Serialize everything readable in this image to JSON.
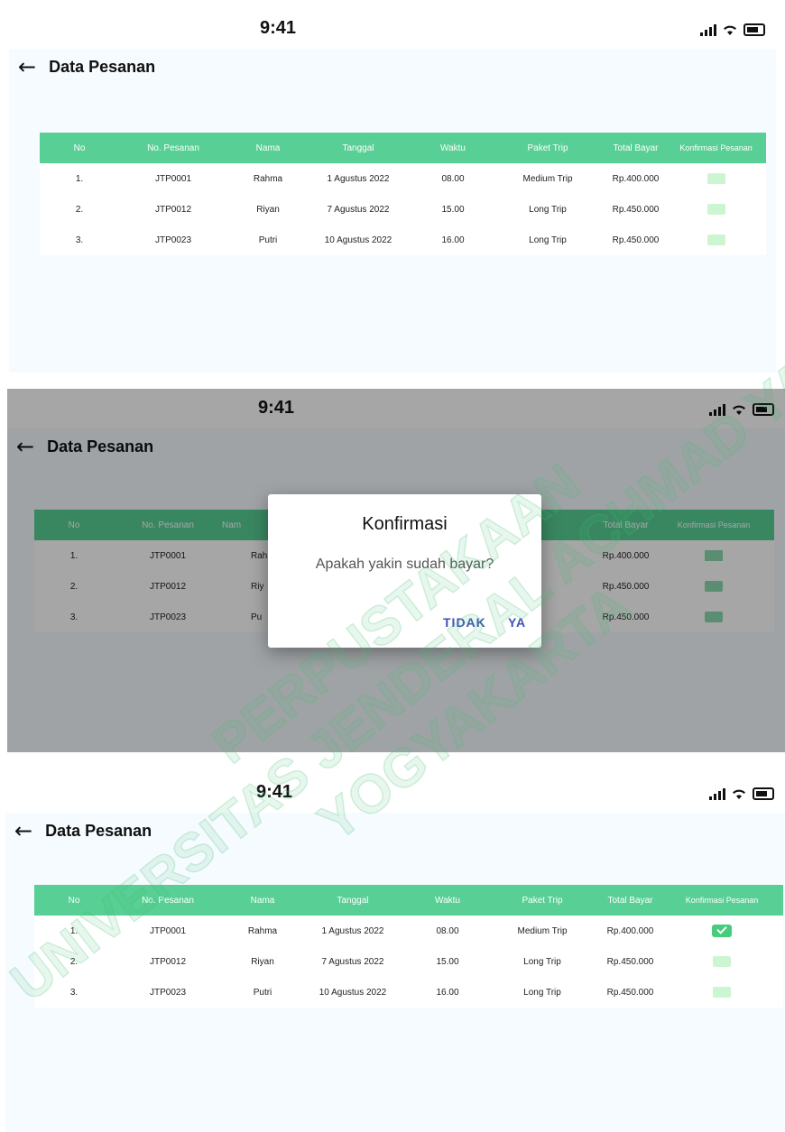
{
  "status_bar": {
    "time": "9:41"
  },
  "header": {
    "title": "Data Pesanan"
  },
  "table": {
    "columns": [
      "No",
      "No. Pesanan",
      "Nama",
      "Tanggal",
      "Waktu",
      "Paket Trip",
      "Total Bayar",
      "Konfirmasi Pesanan"
    ],
    "rows": [
      {
        "no": "1.",
        "order": "JTP0001",
        "name": "Rahma",
        "date": "1 Agustus 2022",
        "time": "08.00",
        "package": "Medium Trip",
        "total": "Rp.400.000"
      },
      {
        "no": "2.",
        "order": "JTP0012",
        "name": "Riyan",
        "date": "7 Agustus 2022",
        "time": "15.00",
        "package": "Long Trip",
        "total": "Rp.450.000"
      },
      {
        "no": "3.",
        "order": "JTP0023",
        "name": "Putri",
        "date": "10 Agustus 2022",
        "time": "16.00",
        "package": "Long Trip",
        "total": "Rp.450.000"
      }
    ]
  },
  "dialog": {
    "title": "Konfirmasi",
    "message": "Apakah yakin sudah bayar?",
    "cancel_label": "TIDAK",
    "ok_label": "YA"
  },
  "mid_table": {
    "columns": [
      "No",
      "No. Pesanan",
      "Nama",
      "Total Bayar",
      "Konfirmasi Pesanan"
    ],
    "rows": [
      {
        "no": "1.",
        "order": "JTP0001",
        "name_frag": "Rah",
        "pkg_frag": "m Trip",
        "total": "Rp.400.000"
      },
      {
        "no": "2.",
        "order": "JTP0012",
        "name_frag": "Riy",
        "pkg_frag": "g Trip",
        "total": "Rp.450.000"
      },
      {
        "no": "3.",
        "order": "JTP0023",
        "name_frag": "Pu",
        "pkg_frag": "g Trip",
        "total": "Rp.450.000"
      }
    ],
    "header_frag_nama": "Nam",
    "header_frag_paket": "t Trip"
  },
  "watermark": {
    "line1": "PERPUSTAKAAN",
    "line2": "UNIVERSITAS JENDERAL ACHMAD YANI",
    "line3": "YOGYAKARTA"
  },
  "colors": {
    "accent": "#58cf95",
    "checkbox_empty": "#ccf5d2",
    "checkbox_checked": "#45cc7d",
    "dialog_button": "#3f51b5"
  }
}
